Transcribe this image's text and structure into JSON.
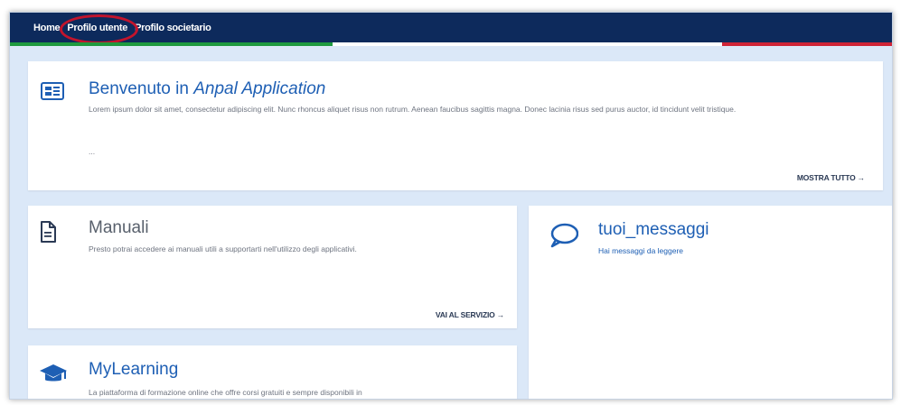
{
  "nav": {
    "items": [
      "Home",
      "Profilo utente",
      "Profilo societario"
    ]
  },
  "colors": {
    "navbar": "#0d2a5c",
    "accent": "#1e5fb4",
    "highlight_circle": "#c3142c",
    "flag_green": "#1f9a3f",
    "flag_red": "#cf2336"
  },
  "welcome": {
    "icon": "id-card-icon",
    "title_prefix": "Benvenuto in ",
    "title_app": "Anpal Application",
    "description": "Lorem ipsum dolor sit amet, consectetur adipiscing elit. Nunc rhoncus aliquet risus non rutrum. Aenean faucibus sagittis magna. Donec lacinia risus sed purus auctor, id tincidunt velit tristique.",
    "ellipsis": "...",
    "link": "MOSTRA TUTTO →"
  },
  "manuali": {
    "icon": "document-icon",
    "title": "Manuali",
    "description": "Presto potrai accedere ai manuali utili a supportarti nell'utilizzo degli applicativi.",
    "link": "VAI AL SERVIZIO →"
  },
  "messaggi": {
    "icon": "speech-bubble-icon",
    "title": "tuoi_messaggi",
    "subtitle": "Hai messaggi da leggere"
  },
  "learning": {
    "icon": "graduation-cap-icon",
    "title": "MyLearning",
    "description": "La piattaforma di formazione online che offre corsi gratuiti e sempre disponibili in"
  }
}
